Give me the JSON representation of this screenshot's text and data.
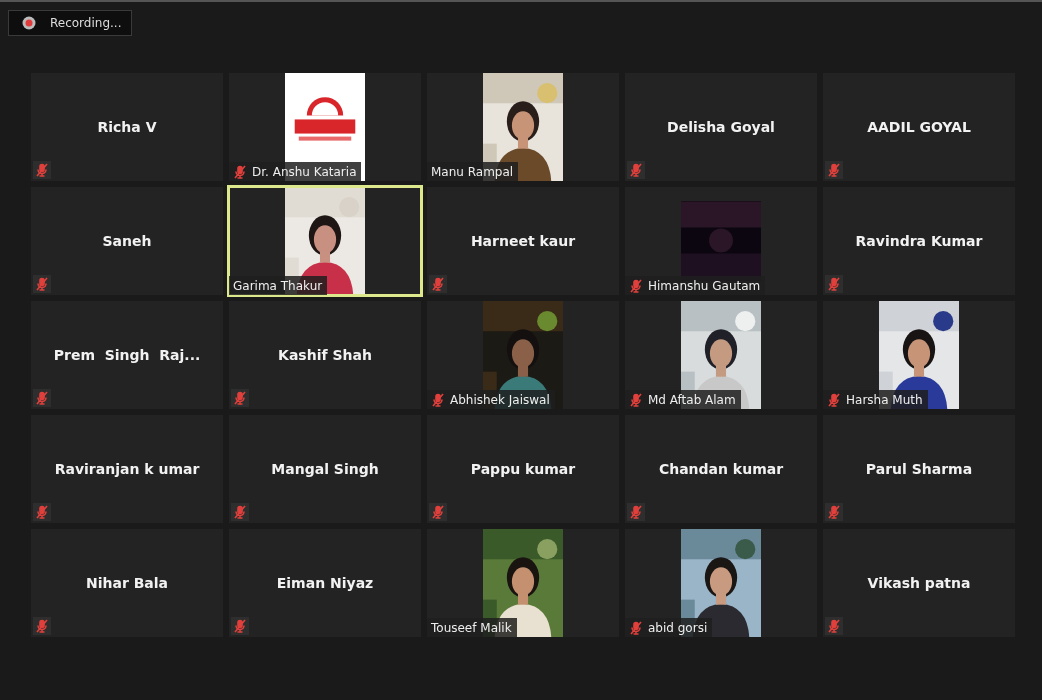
{
  "recording": {
    "label": "Recording..."
  },
  "tiles": [
    {
      "name": "Richa V",
      "kind": "name",
      "muted": true,
      "speaking": false
    },
    {
      "name": "Dr. Anshu Kataria",
      "kind": "video",
      "muted": true,
      "speaking": false
    },
    {
      "name": "Manu Rampal",
      "kind": "video",
      "muted": false,
      "speaking": false
    },
    {
      "name": "Delisha Goyal",
      "kind": "name",
      "muted": true,
      "speaking": false
    },
    {
      "name": "AADIL GOYAL",
      "kind": "name",
      "muted": true,
      "speaking": false
    },
    {
      "name": "Saneh",
      "kind": "name",
      "muted": true,
      "speaking": false
    },
    {
      "name": "Garima Thakur",
      "kind": "video",
      "muted": false,
      "speaking": true
    },
    {
      "name": "Harneet kaur",
      "kind": "name",
      "muted": true,
      "speaking": false
    },
    {
      "name": "Himanshu Gautam",
      "kind": "video",
      "muted": true,
      "speaking": false
    },
    {
      "name": "Ravindra Kumar",
      "kind": "name",
      "muted": true,
      "speaking": false
    },
    {
      "name": "Prem  Singh  Raj...",
      "kind": "name",
      "muted": true,
      "speaking": false
    },
    {
      "name": "Kashif Shah",
      "kind": "name",
      "muted": true,
      "speaking": false
    },
    {
      "name": "Abhishek Jaiswal",
      "kind": "video",
      "muted": true,
      "speaking": false
    },
    {
      "name": "Md Aftab Alam",
      "kind": "video",
      "muted": true,
      "speaking": false
    },
    {
      "name": "Harsha Muth",
      "kind": "video",
      "muted": true,
      "speaking": false
    },
    {
      "name": "Raviranjan k umar",
      "kind": "name",
      "muted": true,
      "speaking": false
    },
    {
      "name": "Mangal Singh",
      "kind": "name",
      "muted": true,
      "speaking": false
    },
    {
      "name": "Pappu kumar",
      "kind": "name",
      "muted": true,
      "speaking": false
    },
    {
      "name": "Chandan kumar",
      "kind": "name",
      "muted": true,
      "speaking": false
    },
    {
      "name": "Parul Sharma",
      "kind": "name",
      "muted": true,
      "speaking": false
    },
    {
      "name": "Nihar Bala",
      "kind": "name",
      "muted": true,
      "speaking": false
    },
    {
      "name": "Eiman Niyaz",
      "kind": "name",
      "muted": true,
      "speaking": false
    },
    {
      "name": "Touseef Malik",
      "kind": "video",
      "muted": false,
      "speaking": false
    },
    {
      "name": "abid gorsi",
      "kind": "video",
      "muted": true,
      "speaking": false
    },
    {
      "name": "Vikash patna",
      "kind": "name",
      "muted": true,
      "speaking": false
    }
  ]
}
